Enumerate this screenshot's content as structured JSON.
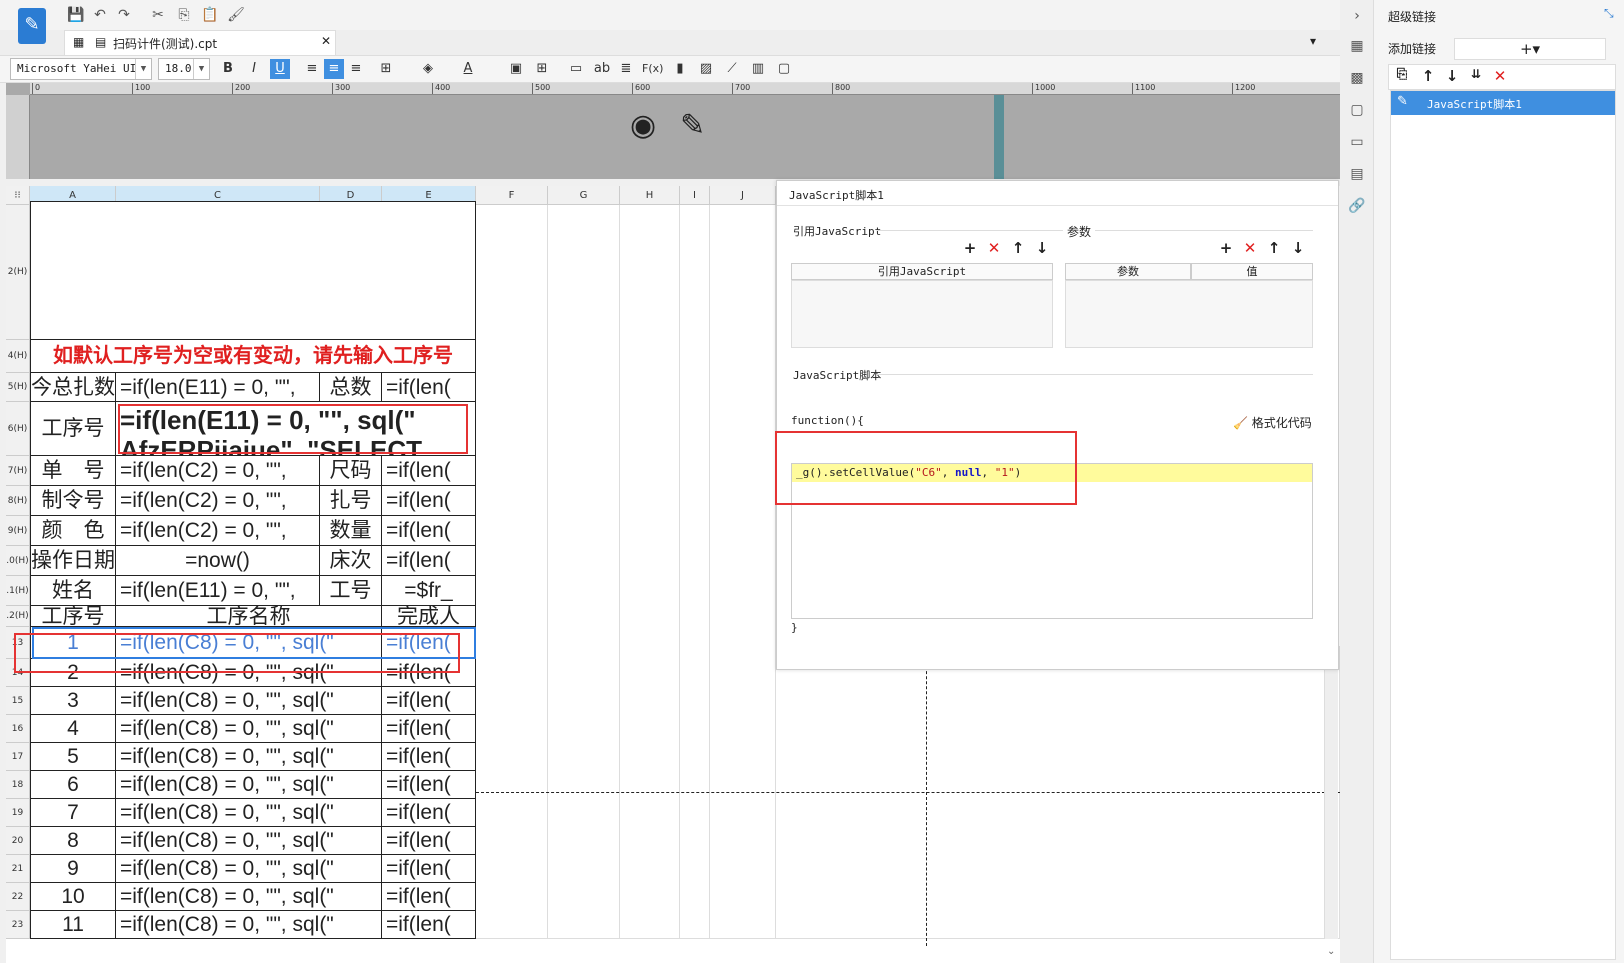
{
  "toolbar": {
    "file_tab_label": "扫码计件(测试).cpt",
    "font_name": "Microsoft YaHei UI",
    "font_size": "18.0"
  },
  "ruler": {
    "ticks": [
      "0",
      "100",
      "200",
      "300",
      "400",
      "500",
      "600",
      "700",
      "800",
      "1000",
      "1100",
      "1200"
    ]
  },
  "sheet": {
    "columns": [
      "A",
      "C",
      "D",
      "E",
      "F",
      "G",
      "H",
      "I",
      "J"
    ],
    "rows": [
      {
        "label": "2(H)"
      },
      {
        "label": "4(H)"
      },
      {
        "label": "5(H)"
      },
      {
        "label": "6(H)"
      },
      {
        "label": "7(H)"
      },
      {
        "label": "8(H)"
      },
      {
        "label": "9(H)"
      },
      {
        "label": ".0(H)"
      },
      {
        "label": ".1(H)"
      },
      {
        "label": ".2(H)"
      },
      {
        "label": "13"
      },
      {
        "label": "14"
      },
      {
        "label": "15"
      },
      {
        "label": "16"
      },
      {
        "label": "17"
      },
      {
        "label": "18"
      },
      {
        "label": "19"
      },
      {
        "label": "20"
      },
      {
        "label": "21"
      },
      {
        "label": "22"
      },
      {
        "label": "23"
      }
    ],
    "notice": "如默认工序号为空或有变动，请先输入工序号",
    "r5": [
      "今总扎数",
      "=if(len(E11) = 0, \"\",",
      "总数",
      "=if(len("
    ],
    "r6": [
      "工序号",
      "=if(len(E11) = 0, \"\", sql(\" AfzERPjiajue\", \"SELECT"
    ],
    "r7": [
      "单　号",
      "=if(len(C2) = 0, \"\",",
      "尺码",
      "=if(len("
    ],
    "r8": [
      "制令号",
      "=if(len(C2) = 0, \"\",",
      "扎号",
      "=if(len("
    ],
    "r9": [
      "颜　色",
      "=if(len(C2) = 0, \"\",",
      "数量",
      "=if(len("
    ],
    "r10": [
      "操作日期",
      "=now()",
      "床次",
      "=if(len("
    ],
    "r11": [
      "姓名",
      "=if(len(E11) = 0, \"\",",
      "工号",
      "=$fr_"
    ],
    "r12": [
      "工序号",
      "工序名称",
      "完成人"
    ],
    "data_rows": [
      {
        "num": "1",
        "c": "=if(len(C8) = 0, \"\", sql(\"",
        "e": "=if(len("
      },
      {
        "num": "2",
        "c": "=if(len(C8) = 0, \"\", sql(\"",
        "e": "=if(len("
      },
      {
        "num": "3",
        "c": "=if(len(C8) = 0, \"\", sql(\"",
        "e": "=if(len("
      },
      {
        "num": "4",
        "c": "=if(len(C8) = 0, \"\", sql(\"",
        "e": "=if(len("
      },
      {
        "num": "5",
        "c": "=if(len(C8) = 0, \"\", sql(\"",
        "e": "=if(len("
      },
      {
        "num": "6",
        "c": "=if(len(C8) = 0, \"\", sql(\"",
        "e": "=if(len("
      },
      {
        "num": "7",
        "c": "=if(len(C8) = 0, \"\", sql(\"",
        "e": "=if(len("
      },
      {
        "num": "8",
        "c": "=if(len(C8) = 0, \"\", sql(\"",
        "e": "=if(len("
      },
      {
        "num": "9",
        "c": "=if(len(C8) = 0, \"\", sql(\"",
        "e": "=if(len("
      },
      {
        "num": "10",
        "c": "=if(len(C8) = 0, \"\", sql(\"",
        "e": "=if(len("
      },
      {
        "num": "11",
        "c": "=if(len(C8) = 0, \"\", sql(\"",
        "e": "=if(len("
      }
    ]
  },
  "js_dialog": {
    "title": "JavaScript脚本1",
    "ref_section": "引用JavaScript",
    "ref_col": "引用JavaScript",
    "param_section": "参数",
    "param_col_name": "参数",
    "param_col_value": "值",
    "script_section": "JavaScript脚本",
    "function_open": "function(){",
    "format_code": "格式化代码",
    "code_prefix": "_g().setCellValue(",
    "code_str1": "\"C6\"",
    "code_sep1": ", ",
    "code_null": "null",
    "code_sep2": ", ",
    "code_str2": "\"1\"",
    "code_suffix": ")",
    "function_close": "}"
  },
  "right_panel": {
    "title": "超级链接",
    "add_label": "添加链接",
    "list_items": [
      "JavaScript脚本1"
    ]
  },
  "colors": {
    "accent": "#3f8fe0",
    "highlight_box": "#e53333",
    "code_highlight": "#fffb9c"
  }
}
